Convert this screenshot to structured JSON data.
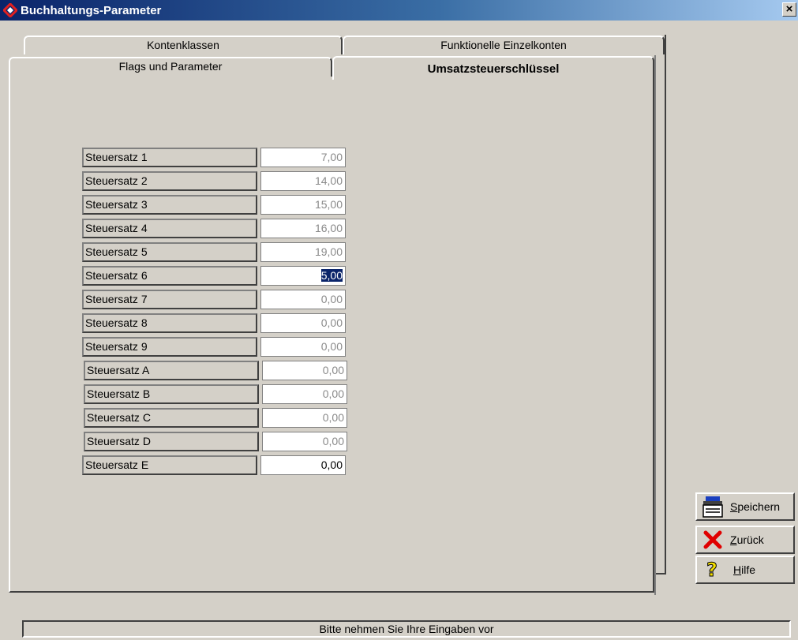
{
  "window": {
    "title": "Buchhaltungs-Parameter",
    "close_label": "×"
  },
  "tabs": {
    "back_row": [
      {
        "label": "Kontenklassen"
      },
      {
        "label": "Funktionelle Einzelkonten"
      }
    ],
    "front_row": [
      {
        "label": "Flags und Parameter"
      },
      {
        "label": "Umsatzsteuerschlüssel"
      }
    ],
    "active": "Umsatzsteuerschlüssel"
  },
  "rates": [
    {
      "label": "Steuersatz 1",
      "value": "7,00"
    },
    {
      "label": "Steuersatz 2",
      "value": "14,00"
    },
    {
      "label": "Steuersatz 3",
      "value": "15,00"
    },
    {
      "label": "Steuersatz 4",
      "value": "16,00"
    },
    {
      "label": "Steuersatz 5",
      "value": "19,00"
    },
    {
      "label": "Steuersatz 6",
      "value": "5,00",
      "selected": true
    },
    {
      "label": "Steuersatz 7",
      "value": "0,00"
    },
    {
      "label": "Steuersatz 8",
      "value": "0,00"
    },
    {
      "label": "Steuersatz 9",
      "value": "0,00"
    },
    {
      "label": "Steuersatz A",
      "value": "0,00"
    },
    {
      "label": "Steuersatz B",
      "value": "0,00"
    },
    {
      "label": "Steuersatz C",
      "value": "0,00"
    },
    {
      "label": "Steuersatz D",
      "value": "0,00"
    },
    {
      "label": "Steuersatz E",
      "value": "0,00"
    }
  ],
  "buttons": {
    "save": {
      "label": "Speichern",
      "icon": "printer-save-icon"
    },
    "back": {
      "label": "Zurück",
      "icon": "red-x-icon"
    },
    "help": {
      "label": "Hilfe",
      "icon": "question-mark-icon"
    }
  },
  "status": {
    "text": "Bitte nehmen Sie Ihre Eingaben vor"
  },
  "colors": {
    "title_bar": "#0a246a",
    "selection": "#0a246a",
    "face": "#d4d0c8"
  }
}
